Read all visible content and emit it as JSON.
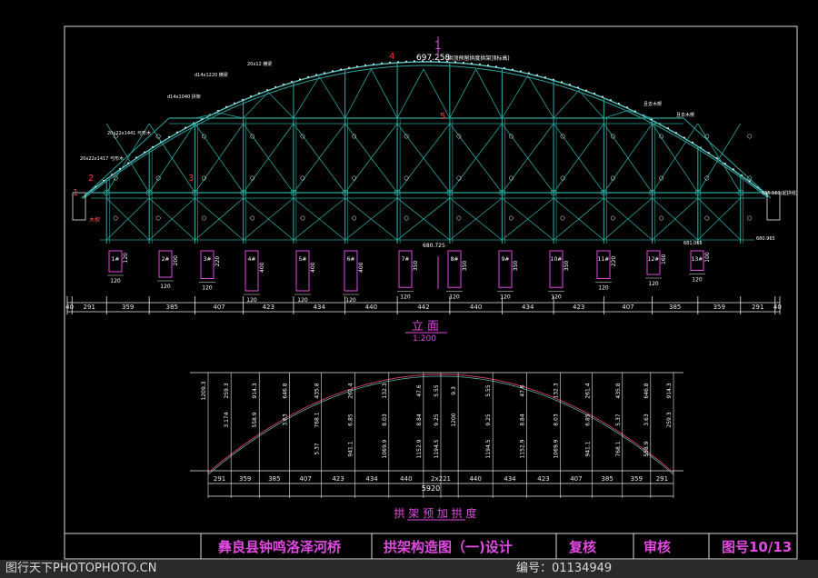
{
  "elevation": {
    "title": "立 面",
    "scale": "1:200",
    "top_elev": "697.258",
    "top_note": "(拱顶预留拱度拱架顶标高)",
    "mid_elev": "680.725",
    "end_elev_right": "685.163(起拱线)",
    "bottom_elev_right": "681.065",
    "right_low_elev": "680.965",
    "left_labels": [
      "木楔",
      "20x22x1417 弓形木",
      "20x22x1441 弓形木",
      "d14x1040 拱架",
      "d14x1220 横梁",
      "20x12 横梁"
    ],
    "right_labels": [
      "且去木楔",
      "且去木楔"
    ],
    "callouts_red": [
      "1",
      "2",
      "3",
      "4",
      "5",
      "1"
    ],
    "dims_top": [
      "40",
      "291",
      "359",
      "385",
      "407",
      "423",
      "434",
      "440",
      "442",
      "440",
      "434",
      "423",
      "407",
      "385",
      "359",
      "291",
      "40"
    ],
    "piers": [
      {
        "label": "1#",
        "h": "120",
        "w": "120"
      },
      {
        "label": "2#",
        "h": "200",
        "w": "120"
      },
      {
        "label": "3#",
        "h": "220",
        "w": "120"
      },
      {
        "label": "4#",
        "h": "400",
        "w": "120"
      },
      {
        "label": "5#",
        "h": "400",
        "w": "120"
      },
      {
        "label": "6#",
        "h": "400",
        "w": "120"
      },
      {
        "label": "7#",
        "h": "350",
        "w": "120"
      },
      {
        "label": "8#",
        "h": "350",
        "w": "120"
      },
      {
        "label": "9#",
        "h": "350",
        "w": "120"
      },
      {
        "label": "10#",
        "h": "350",
        "w": "120"
      },
      {
        "label": "11#",
        "h": "220",
        "w": "120"
      },
      {
        "label": "12#",
        "h": "160",
        "w": "120"
      },
      {
        "label": "13#",
        "h": "100",
        "w": "120"
      }
    ]
  },
  "camber": {
    "title": "拱 架 预 加 拱 度",
    "dims": [
      "291",
      "359",
      "385",
      "407",
      "423",
      "434",
      "440",
      "2x221",
      "440",
      "434",
      "423",
      "407",
      "385",
      "359",
      "291"
    ],
    "total": "5920",
    "verticals": [
      [
        "1209.3"
      ],
      [
        "259.3",
        "3.174"
      ],
      [
        "914.3",
        "558.9"
      ],
      [
        "646.8",
        "3.63"
      ],
      [
        "435.8",
        "768.1",
        "5.37"
      ],
      [
        "261.4",
        "6.85",
        "941.1"
      ],
      [
        "132.3",
        "8.03",
        "1069.9"
      ],
      [
        "47.6",
        "8.84",
        "1152.9"
      ],
      [
        "5.55",
        "9.25",
        "1194.5"
      ],
      [
        "9.3",
        "1200"
      ],
      [
        "5.55",
        "9.25",
        "1194.5"
      ],
      [
        "47.6",
        "8.84",
        "1152.9"
      ],
      [
        "132.3",
        "8.03",
        "1069.9"
      ],
      [
        "261.4",
        "6.85",
        "941.1"
      ],
      [
        "435.8",
        "5.37",
        "768.1"
      ],
      [
        "646.8",
        "3.63",
        "558.9"
      ],
      [
        "914.3",
        "259.3"
      ],
      [
        "3.174",
        "1209.3"
      ]
    ]
  },
  "title_block": {
    "project": "彝良县钟鸣洛泽河桥",
    "drawing": "拱架构造图（一)设计",
    "review": "复核",
    "approve": "审核",
    "sheet": "图号10/13"
  },
  "watermark": {
    "left": "图行天下PHOTOPHOTO.CN",
    "right": "编号：01134949"
  },
  "colors": {
    "frame": "#d8d8d8",
    "arch": "#5fc3c3",
    "truss": "#2aa39a",
    "dim": "#e8e8e8",
    "title": "#e24ae2",
    "callout": "#ff3030",
    "pier": "#e24ae2"
  }
}
